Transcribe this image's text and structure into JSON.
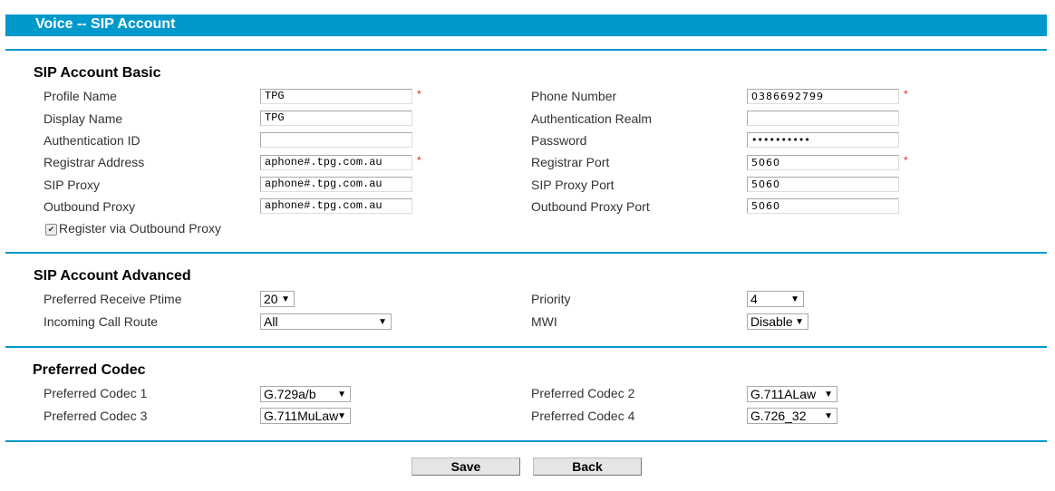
{
  "header": {
    "title": "Voice -- SIP Account"
  },
  "colors": {
    "accent": "#0099cc",
    "required": "#ee2222"
  },
  "basic": {
    "title": "SIP Account Basic",
    "profile_name": {
      "label": "Profile Name",
      "value": "TPG",
      "required": "*"
    },
    "display_name": {
      "label": "Display Name",
      "value": "TPG"
    },
    "auth_id": {
      "label": "Authentication ID",
      "value": ""
    },
    "registrar_address": {
      "label": "Registrar Address",
      "value": "aphone#.tpg.com.au",
      "required": "*"
    },
    "sip_proxy": {
      "label": "SIP Proxy",
      "value": "aphone#.tpg.com.au"
    },
    "outbound_proxy": {
      "label": "Outbound Proxy",
      "value": "aphone#.tpg.com.au"
    },
    "phone_number": {
      "label": "Phone Number",
      "value": "0386692799",
      "required": "*"
    },
    "auth_realm": {
      "label": "Authentication Realm",
      "value": ""
    },
    "password": {
      "label": "Password",
      "value": "••••••••••"
    },
    "registrar_port": {
      "label": "Registrar Port",
      "value": "5060",
      "required": "*"
    },
    "sip_proxy_port": {
      "label": "SIP Proxy Port",
      "value": "5060"
    },
    "outbound_proxy_port": {
      "label": "Outbound Proxy Port",
      "value": "5060"
    },
    "register_via_outbound": {
      "label": "Register via Outbound Proxy",
      "checked": true,
      "check_glyph": "✔"
    }
  },
  "advanced": {
    "title": "SIP Account Advanced",
    "ptime": {
      "label": "Preferred Receive Ptime",
      "value": "20"
    },
    "incoming_route": {
      "label": "Incoming Call Route",
      "value": "All"
    },
    "priority": {
      "label": "Priority",
      "value": "4"
    },
    "mwi": {
      "label": "MWI",
      "value": "Disable"
    }
  },
  "codec": {
    "title": "Preferred Codec",
    "codec1": {
      "label": "Preferred Codec 1",
      "value": "G.729a/b"
    },
    "codec2": {
      "label": "Preferred Codec 2",
      "value": "G.711ALaw"
    },
    "codec3": {
      "label": "Preferred Codec 3",
      "value": "G.711MuLaw"
    },
    "codec4": {
      "label": "Preferred Codec 4",
      "value": "G.726_32"
    }
  },
  "buttons": {
    "save": "Save",
    "back": "Back"
  },
  "icons": {
    "dropdown_arrow": "▼"
  }
}
